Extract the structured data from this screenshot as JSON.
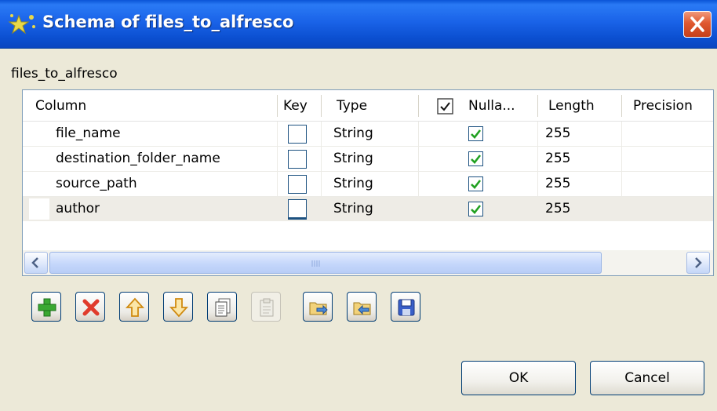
{
  "window": {
    "title": "Schema of files_to_alfresco"
  },
  "schema": {
    "name": "files_to_alfresco"
  },
  "table": {
    "columns": [
      "Column",
      "Key",
      "Type",
      "Nulla...",
      "Length",
      "Precision"
    ],
    "rows": [
      {
        "column": "file_name",
        "key": false,
        "type": "String",
        "nullable": true,
        "length": "255",
        "precision": ""
      },
      {
        "column": "destination_folder_name",
        "key": false,
        "type": "String",
        "nullable": true,
        "length": "255",
        "precision": ""
      },
      {
        "column": "source_path",
        "key": false,
        "type": "String",
        "nullable": true,
        "length": "255",
        "precision": ""
      },
      {
        "column": "author",
        "key": false,
        "type": "String",
        "nullable": true,
        "length": "255",
        "precision": ""
      }
    ],
    "selected_row": 3,
    "nullable_header_checked": true
  },
  "toolbar": {
    "icons": [
      "add-icon",
      "delete-icon",
      "move-up-icon",
      "move-down-icon",
      "copy-icon",
      "paste-icon",
      "import-icon",
      "export-icon",
      "save-icon"
    ]
  },
  "buttons": {
    "ok": "OK",
    "cancel": "Cancel"
  },
  "colors": {
    "titlebar": "#0a54d6",
    "check_green": "#21a121",
    "delete_red": "#e03b2c",
    "arrow_orange": "#e8a020",
    "accent_blue": "#1c5180"
  }
}
